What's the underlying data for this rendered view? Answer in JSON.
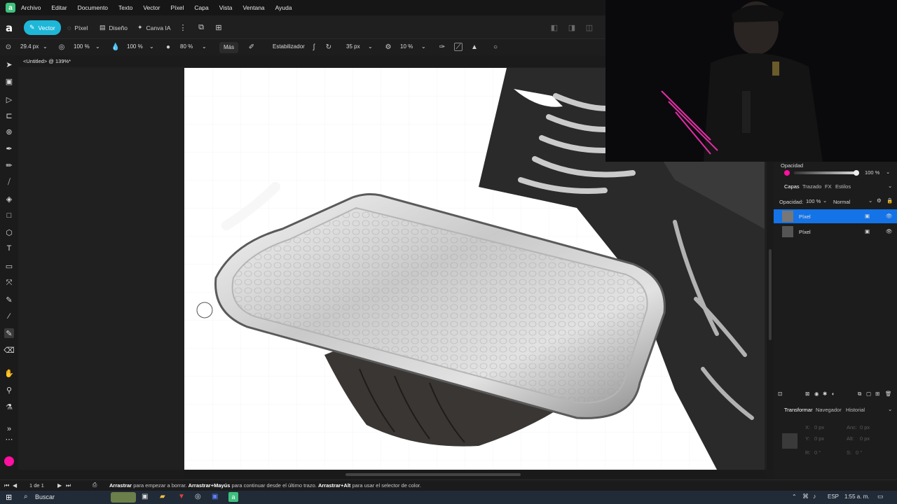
{
  "menu": [
    "Archivo",
    "Editar",
    "Documento",
    "Texto",
    "Vector",
    "Píxel",
    "Capa",
    "Vista",
    "Ventana",
    "Ayuda"
  ],
  "personas": {
    "vector": "Vector",
    "pixel": "Píxel",
    "design": "Diseño",
    "canva_ai": "Canva IA"
  },
  "context": {
    "brush_size": "29.4 px",
    "opacity1": "100 %",
    "flow": "100 %",
    "hardness": "80 %",
    "more": "Más",
    "stabilizer": "Estabilizador",
    "rope_length": "35 px",
    "tolerance": "10 %"
  },
  "document": {
    "tab_title": "<Untitled> @ 139%*"
  },
  "right": {
    "opacity_label": "Opacidad",
    "opacity_value": "100 %",
    "tabs": [
      "Capas",
      "Trazado",
      "FX",
      "Estilos"
    ],
    "layer_opacity_label": "Opacidad:",
    "layer_opacity_value": "100 %",
    "blend_mode": "Normal",
    "layers": [
      {
        "name": "Píxel",
        "selected": true
      },
      {
        "name": "Píxel",
        "selected": false
      }
    ],
    "bottom_tabs": [
      "Transformar",
      "Navegador",
      "Historial"
    ],
    "transform": {
      "x": "X:",
      "x_val": "0 px",
      "y": "Y:",
      "y_val": "0 px",
      "w": "Anc:",
      "w_val": "0 px",
      "h": "Alt:",
      "h_val": "0 px",
      "r": "R:",
      "r_val": "0 °",
      "s": "S:",
      "s_val": "0 °"
    }
  },
  "status": {
    "page": "1 de 1",
    "hint_b1": "Arrastrar",
    "hint_t1": "para empezar a borrar.",
    "hint_b2": "Arrastrar+Mayús",
    "hint_t2": "para continuar desde el último trazo.",
    "hint_b3": "Arrastrar+Alt",
    "hint_t3": "para usar el selector de color."
  },
  "taskbar": {
    "search": "Buscar",
    "lang": "ESP",
    "time": "1:55 a. m."
  },
  "colors": {
    "accent": "#1eb7d8",
    "selection": "#1473e6",
    "brand": "#3fc07e",
    "color_swatch": "#ff10a0"
  }
}
